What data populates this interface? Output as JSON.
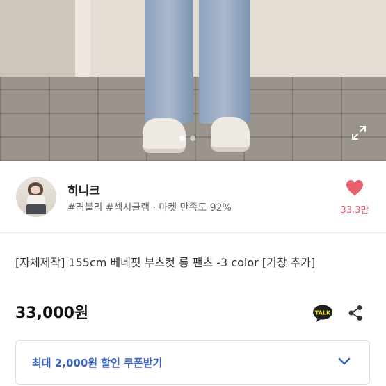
{
  "product_photo": {
    "carousel_total": 2,
    "carousel_active": 1
  },
  "seller": {
    "name": "히니크",
    "tags": "#러블리 #섹시글램 · 마켓 만족도 92%",
    "like_count": "33.3만"
  },
  "product": {
    "title": "[자체제작] 155cm 베네핏 부츠컷 롱 팬츠 -3 color [기장 추가]",
    "price": "33,000원"
  },
  "coupon": {
    "label": "최대 2,000원 할인 쿠폰받기"
  },
  "icons": {
    "expand": "expand-icon",
    "heart": "heart-icon",
    "talk": "kakao-talk-icon",
    "share": "share-icon",
    "chevron": "chevron-down-icon"
  },
  "colors": {
    "like": "#e8606c",
    "coupon_text": "#3761c8",
    "talk_bubble": "#1e1e1e"
  }
}
